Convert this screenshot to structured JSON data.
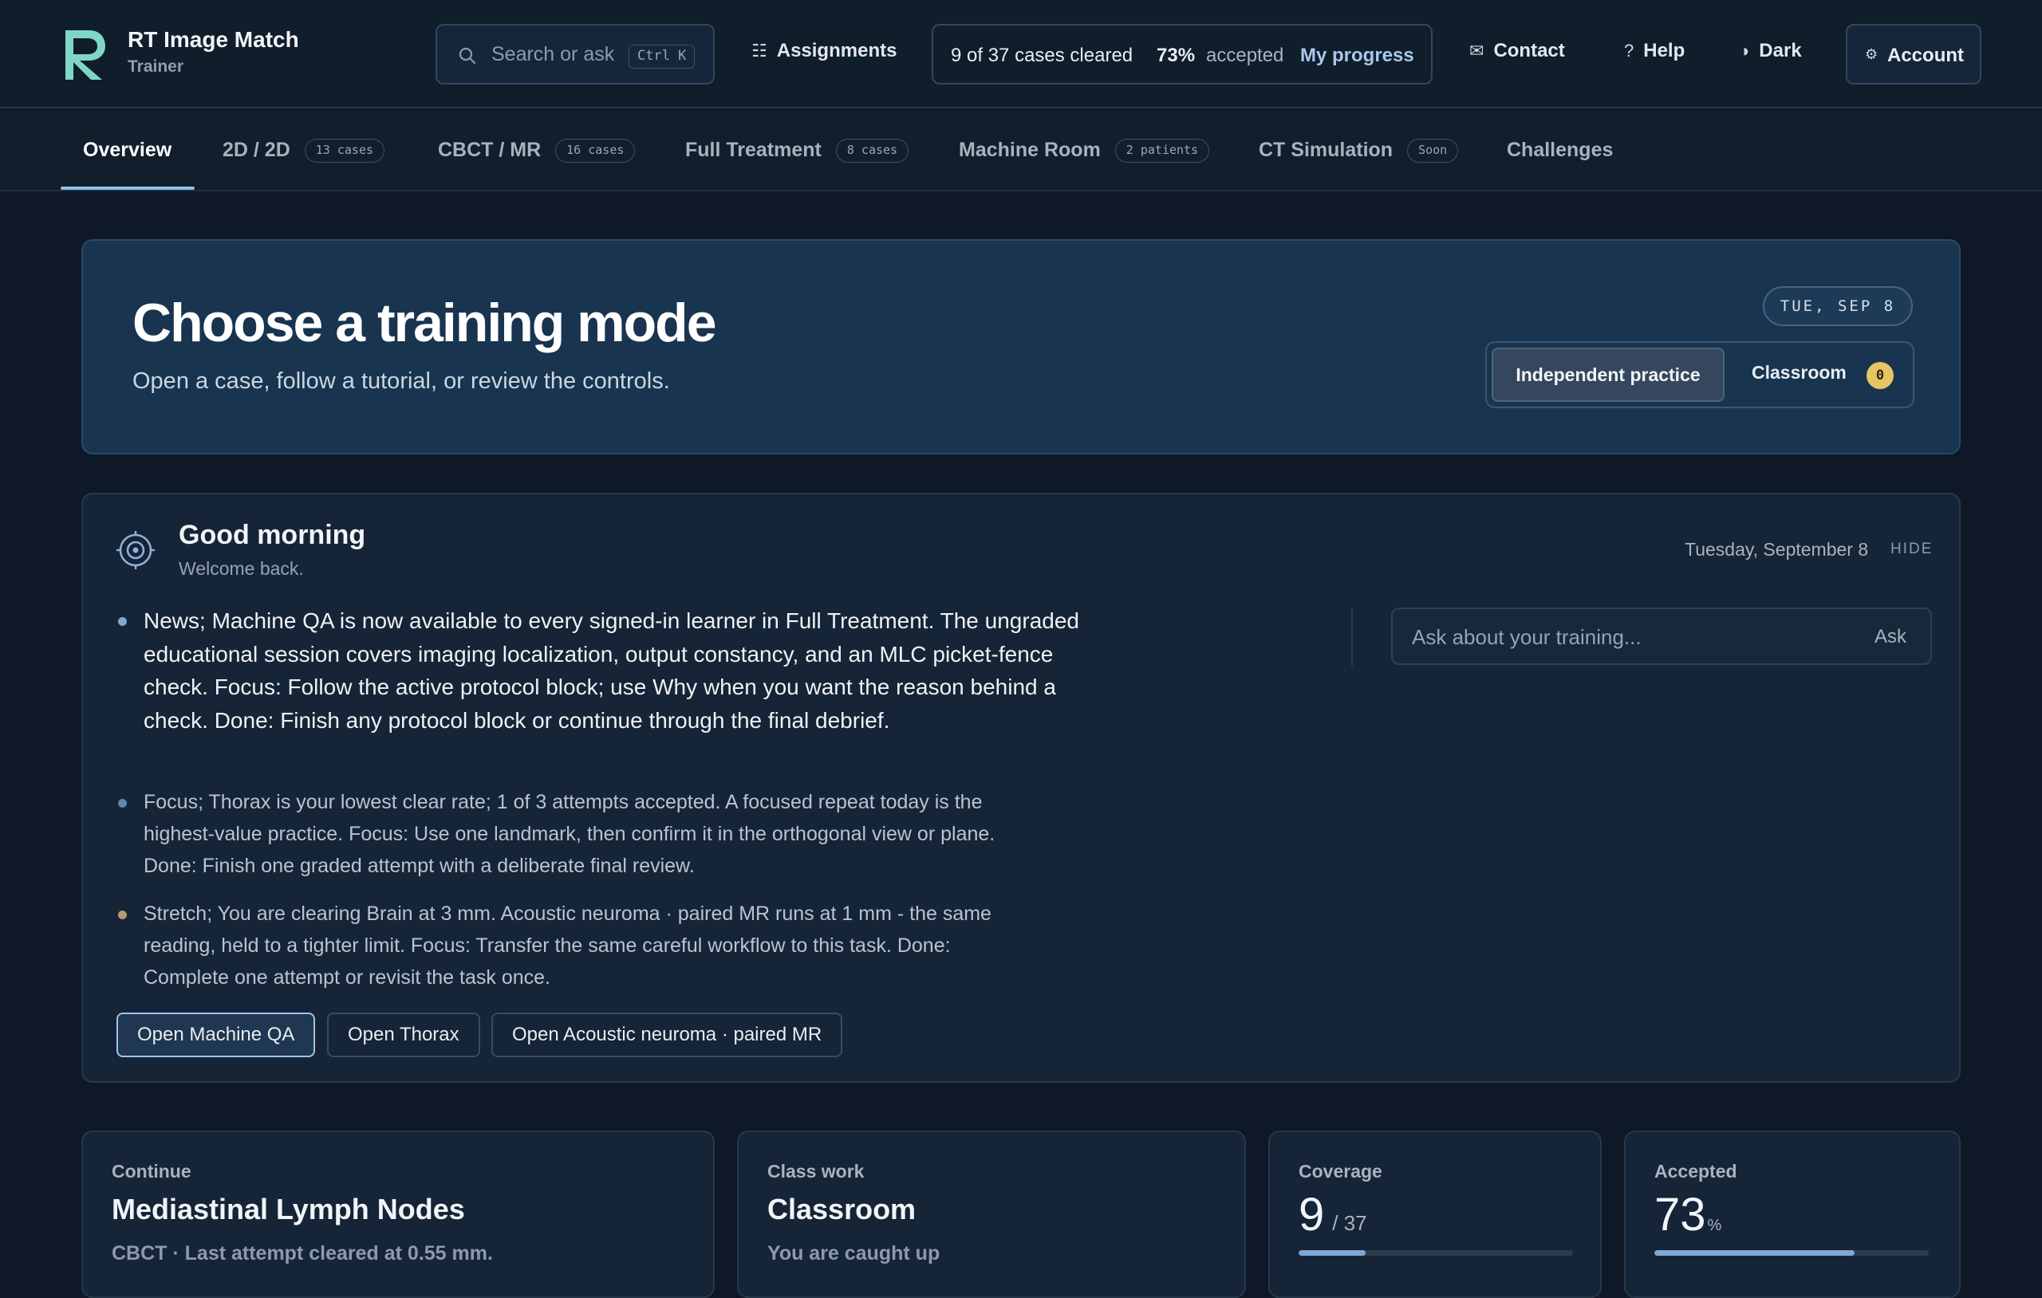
{
  "app": {
    "name": "RT Image Match",
    "subtitle": "Trainer"
  },
  "header": {
    "search_placeholder": "Search or ask",
    "search_shortcut": "Ctrl K",
    "assignments": "Assignments",
    "progress": {
      "cleared_text": "9 of 37 cases cleared",
      "accepted_pct": "73%",
      "accepted_label": "accepted",
      "link": "My progress"
    },
    "contact": "Contact",
    "help": "Help",
    "theme": "Dark",
    "account": "Account",
    "icons": {
      "search": "search-icon",
      "assignments": "grid-icon",
      "contact": "mail-icon",
      "help": "question-icon",
      "theme": "half-circle-icon",
      "account": "gear-icon"
    }
  },
  "tabs": [
    {
      "label": "Overview",
      "badge": ""
    },
    {
      "label": "2D / 2D",
      "badge": "13 cases"
    },
    {
      "label": "CBCT / MR",
      "badge": "16 cases"
    },
    {
      "label": "Full Treatment",
      "badge": "8 cases"
    },
    {
      "label": "Machine Room",
      "badge": "2 patients"
    },
    {
      "label": "CT Simulation",
      "badge": "Soon"
    },
    {
      "label": "Challenges",
      "badge": ""
    }
  ],
  "hero": {
    "title": "Choose a training mode",
    "subtitle": "Open a case, follow a tutorial, or review the controls.",
    "date": "TUE, SEP 8",
    "mode_independent": "Independent practice",
    "mode_classroom": "Classroom",
    "classroom_count": "0"
  },
  "greeting": {
    "title": "Good morning",
    "welcome": "Welcome back.",
    "date": "Tuesday, September 8",
    "hide": "HIDE",
    "bullets": [
      {
        "text": "News; Machine QA is now available to every signed-in learner in Full Treatment. The ungraded educational session covers imaging localization, output constancy, and an MLC picket-fence check. Focus: Follow the active protocol block; use Why when you want the reason behind a check. Done: Finish any protocol block or continue through the final debrief.",
        "color": "#7fa8d2"
      },
      {
        "text": "Focus; Thorax is your lowest clear rate; 1 of 3 attempts accepted. A focused repeat today is the highest-value practice. Focus: Use one landmark, then confirm it in the orthogonal view or plane. Done: Finish one graded attempt with a deliberate final review.",
        "color": "#5f86ad"
      },
      {
        "text": "Stretch; You are clearing Brain at 3 mm. Acoustic neuroma · paired MR runs at 1 mm - the same reading, held to a tighter limit. Focus: Transfer the same careful workflow to this task. Done: Complete one attempt or revisit the task once.",
        "color": "#b59a72"
      }
    ],
    "ask_placeholder": "Ask about your training...",
    "ask_button": "Ask",
    "buttons": [
      "Open Machine QA",
      "Open Thorax",
      "Open Acoustic neuroma · paired MR"
    ]
  },
  "cards": {
    "continue": {
      "label": "Continue",
      "title": "Mediastinal Lymph Nodes",
      "meta": "CBCT · Last attempt cleared at 0.55 mm."
    },
    "classwork": {
      "label": "Class work",
      "title": "Classroom",
      "meta": "You are caught up"
    },
    "coverage": {
      "label": "Coverage",
      "value": "9",
      "total": "/ 37",
      "fill_fraction": 0.243
    },
    "accepted": {
      "label": "Accepted",
      "value": "73",
      "unit": "%",
      "fill_fraction": 0.73
    }
  },
  "colors": {
    "accent": "#8fc0ee",
    "hero_bg": "#18344f",
    "badge_yellow": "#e7c565"
  }
}
